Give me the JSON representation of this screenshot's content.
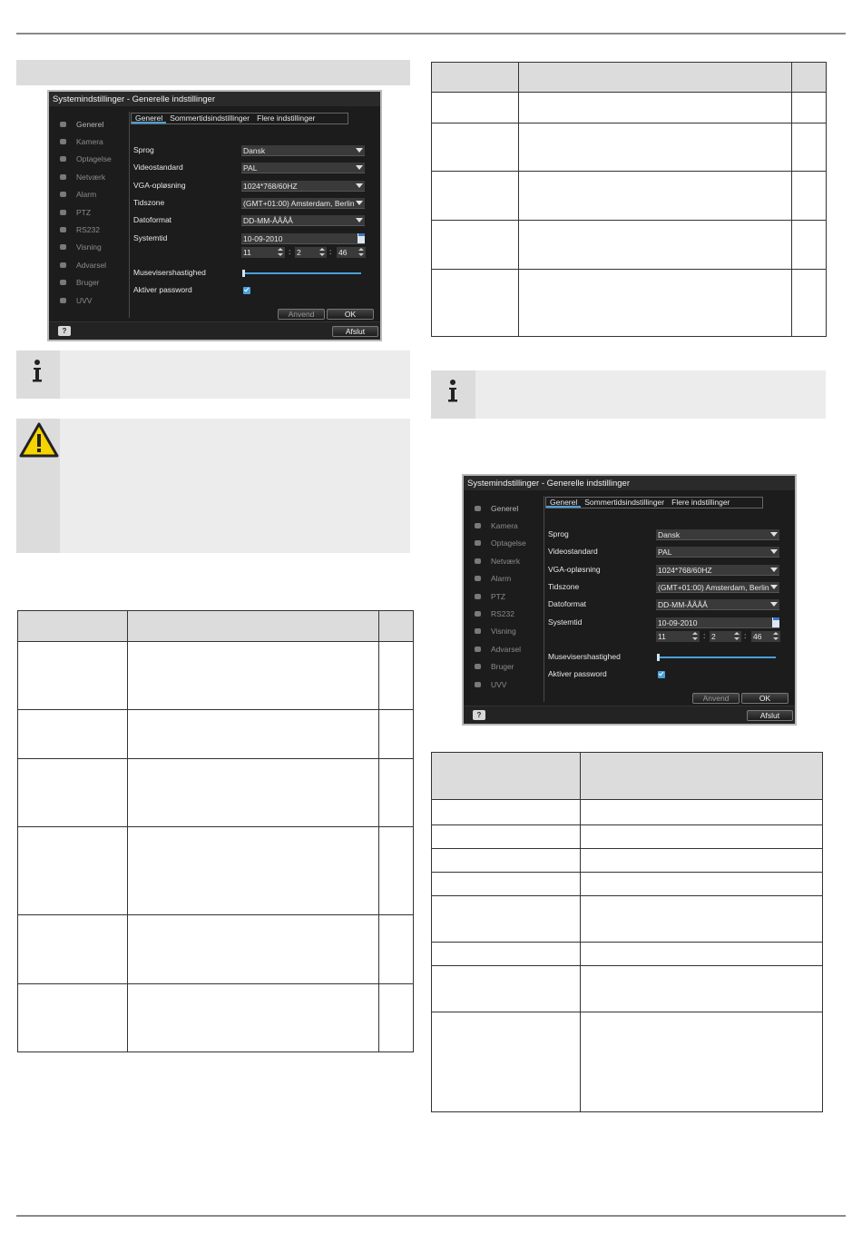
{
  "dialog": {
    "title": "Systemindstillinger - Generelle indstillinger",
    "menu": [
      {
        "label": "Generel",
        "icon": "gear-icon"
      },
      {
        "label": "Kamera",
        "icon": "camera-icon"
      },
      {
        "label": "Optagelse",
        "icon": "record-icon"
      },
      {
        "label": "Netværk",
        "icon": "network-icon"
      },
      {
        "label": "Alarm",
        "icon": "bell-icon"
      },
      {
        "label": "PTZ",
        "icon": "ptz-icon"
      },
      {
        "label": "RS232",
        "icon": "serial-port-icon"
      },
      {
        "label": "Visning",
        "icon": "monitor-icon"
      },
      {
        "label": "Advarsel",
        "icon": "warning-icon"
      },
      {
        "label": "Bruger",
        "icon": "user-icon"
      },
      {
        "label": "UVV",
        "icon": "uvv-icon"
      }
    ],
    "tabs": [
      "Generel",
      "Sommertidsindstillinger",
      "Flere indstillinger"
    ],
    "fields": {
      "sprog": {
        "label": "Sprog",
        "value": "Dansk"
      },
      "videostandard": {
        "label": "Videostandard",
        "value": "PAL"
      },
      "vga": {
        "label": "VGA-opløsning",
        "value": "1024*768/60HZ"
      },
      "tidszone": {
        "label": "Tidszone",
        "value": "(GMT+01:00) Amsterdam, Berlin"
      },
      "datoformat": {
        "label": "Datoformat",
        "value": "DD-MM-ÅÅÅÅ"
      },
      "systemtid": {
        "label": "Systemtid",
        "date": "10-09-2010",
        "hour": "11",
        "minute": "2",
        "second": "46",
        "separator": ":"
      },
      "musehastighed": {
        "label": "Musevisershastighed",
        "level": 0
      },
      "password": {
        "label": "Aktiver password",
        "checked": true
      }
    },
    "buttons": {
      "apply": "Anvend",
      "ok": "OK",
      "exit": "Afslut",
      "help": "?"
    }
  }
}
